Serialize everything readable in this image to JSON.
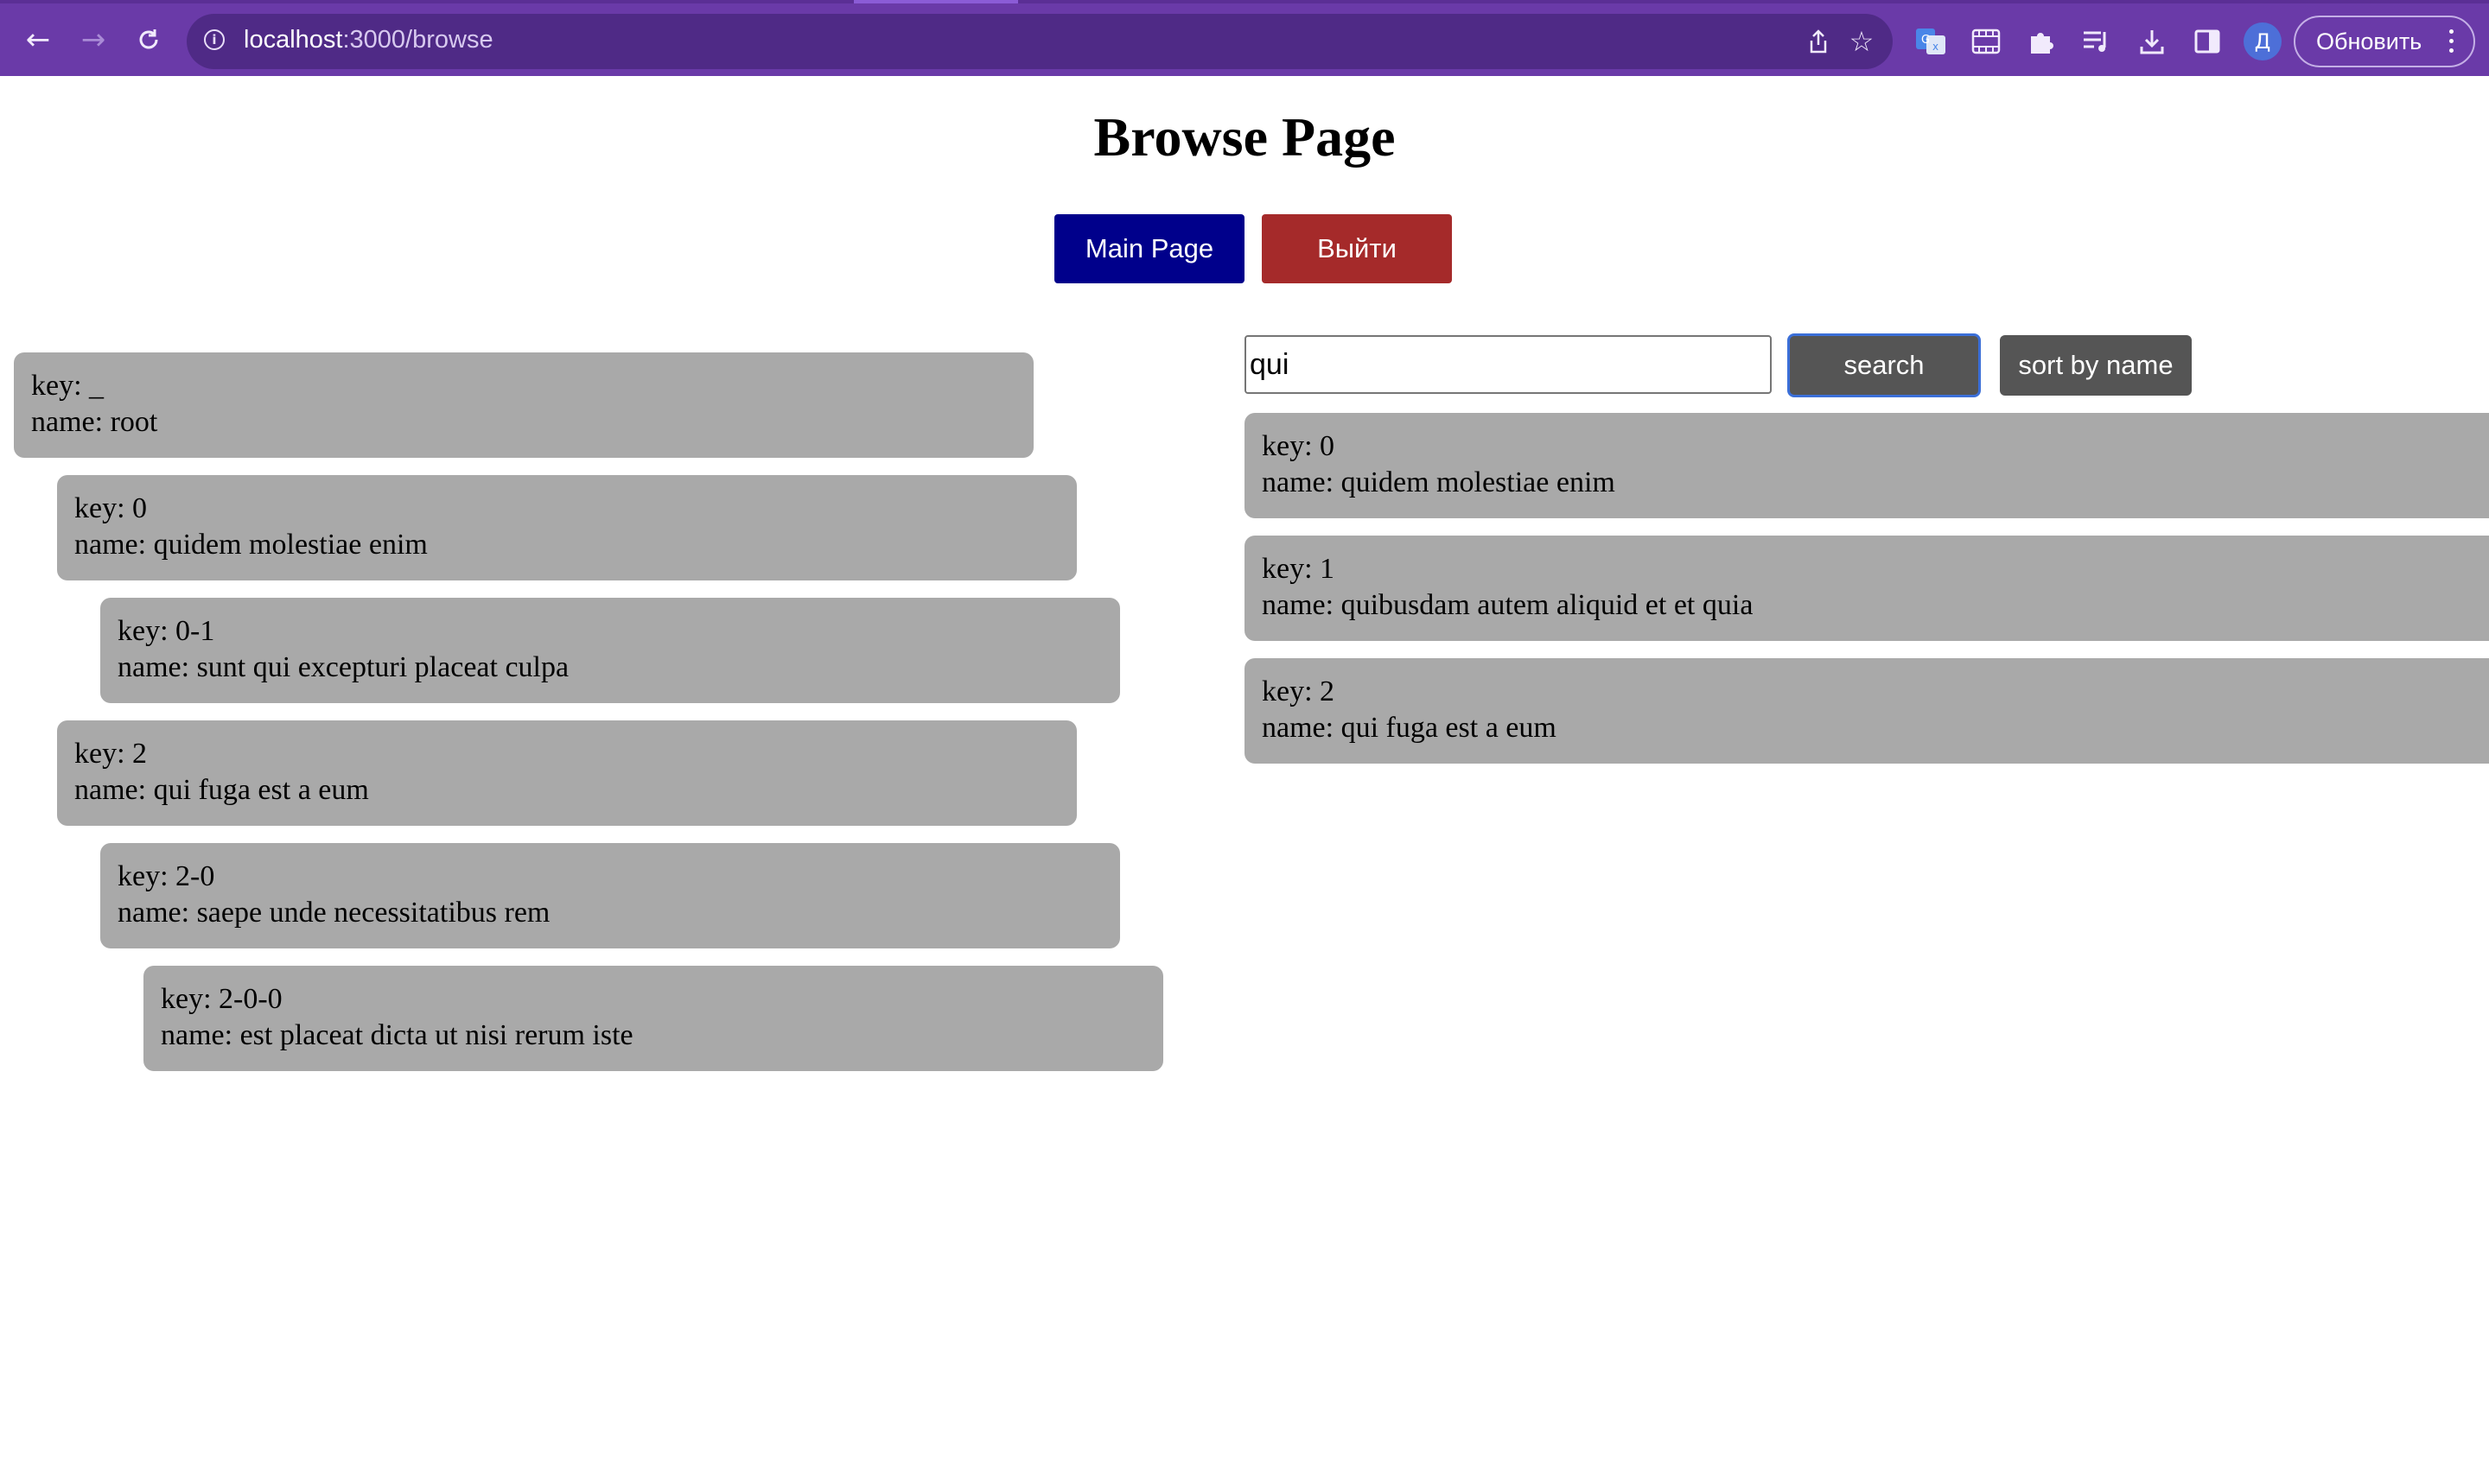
{
  "browser": {
    "url_host": "localhost",
    "url_path": ":3000/browse",
    "profile_initial": "Д",
    "update_label": "Обновить"
  },
  "page": {
    "title": "Browse Page",
    "main_page_label": "Main Page",
    "logout_label": "Выйти"
  },
  "tree": [
    {
      "key": "key: _",
      "name": "name: root"
    },
    {
      "key": "key: 0",
      "name": "name: quidem molestiae enim"
    },
    {
      "key": "key: 0-1",
      "name": "name: sunt qui excepturi placeat culpa"
    },
    {
      "key": "key: 2",
      "name": "name: qui fuga est a eum"
    },
    {
      "key": "key: 2-0",
      "name": "name: saepe unde necessitatibus rem"
    },
    {
      "key": "key: 2-0-0",
      "name": "name: est placeat dicta ut nisi rerum iste"
    }
  ],
  "search": {
    "value": "qui",
    "search_label": "search",
    "sort_label": "sort by name"
  },
  "results": [
    {
      "key": "key: 0",
      "name": "name: quidem molestiae enim"
    },
    {
      "key": "key: 1",
      "name": "name: quibusdam autem aliquid et et quia"
    },
    {
      "key": "key: 2",
      "name": "name: qui fuga est a eum"
    }
  ]
}
